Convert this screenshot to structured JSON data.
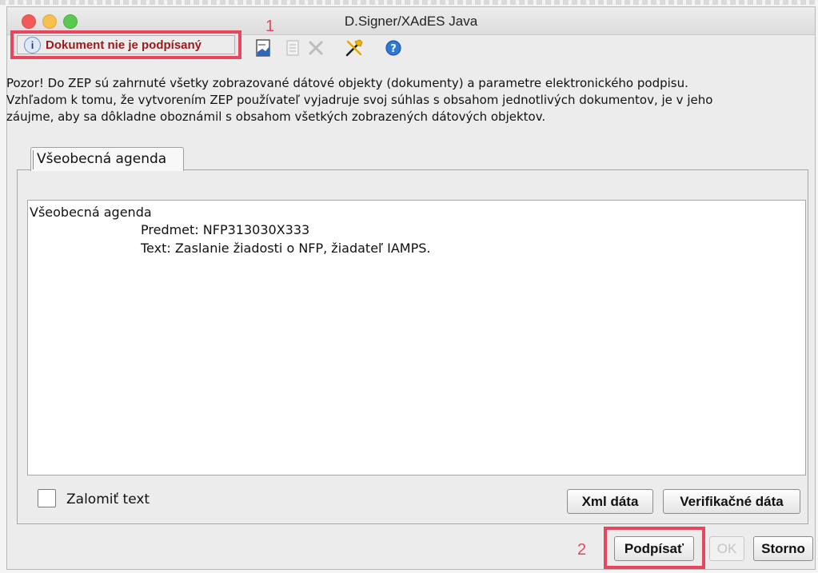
{
  "window": {
    "title": "D.Signer/XAdES Java"
  },
  "toolbar": {
    "status_label": "Dokument nie je podpísaný",
    "status_icon": "info-icon",
    "icons": [
      "document-import-icon",
      "document-icon",
      "close-icon",
      "tools-icon",
      "help-icon"
    ]
  },
  "callouts": {
    "first": "1",
    "second": "2"
  },
  "warning": {
    "line1": "Pozor! Do ZEP sú zahrnuté všetky zobrazované dátové objekty (dokumenty) a parametre elektronického podpisu.",
    "line2": "Vzhľadom k tomu, že vytvorením ZEP používateľ vyjadruje svoj súhlas s obsahom jednotlivých dokumentov, je v jeho",
    "line3": "záujme, aby sa dôkladne oboznámil s obsahom všetkých zobrazených dátových objektov."
  },
  "tabs": [
    {
      "label": "Všeobecná agenda"
    }
  ],
  "content": {
    "title": "Všeobecná agenda",
    "line1": "Predmet: NFP313030X333",
    "line2": "Text: Zaslanie žiadosti o NFP, žiadateľ IAMPS."
  },
  "options": {
    "wrap_text_label": "Zalomiť text"
  },
  "buttons": {
    "xml": "Xml dáta",
    "verify": "Verifikačné dáta",
    "sign": "Podpísať",
    "ok": "OK",
    "cancel": "Storno"
  },
  "colors": {
    "highlight": "#e8465f",
    "status_text": "#981b1b"
  }
}
